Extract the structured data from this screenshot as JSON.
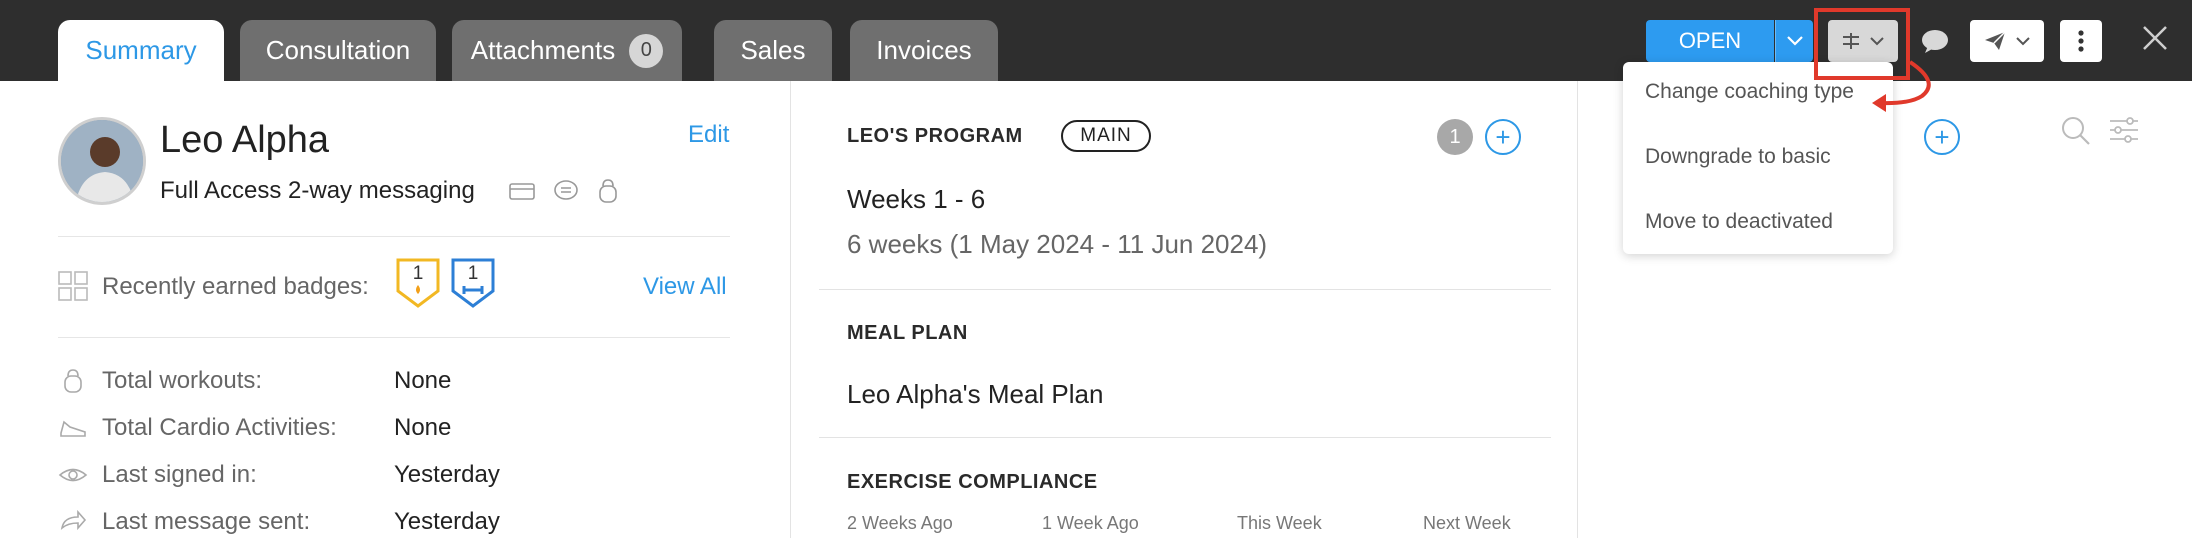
{
  "tabs": [
    {
      "label": "Summary",
      "active": true
    },
    {
      "label": "Consultation"
    },
    {
      "label": "Attachments",
      "count": "0"
    },
    {
      "label": "Sales"
    },
    {
      "label": "Invoices"
    }
  ],
  "toolbar": {
    "status_label": "OPEN",
    "accent_color": "#2d9bf0",
    "highlight_color": "#e0392b"
  },
  "dropdown": {
    "items": [
      "Change coaching type",
      "Downgrade to basic",
      "Move to deactivated"
    ]
  },
  "profile": {
    "name": "Leo Alpha",
    "plan": "Full Access 2-way messaging",
    "edit_label": "Edit"
  },
  "badges": {
    "label": "Recently earned badges:",
    "items": [
      {
        "count": "1",
        "color": "#f2b823",
        "icon": "flame-icon"
      },
      {
        "count": "1",
        "color": "#2d7fd6",
        "icon": "dumbbell-icon"
      }
    ],
    "view_all_label": "View All"
  },
  "stats": [
    {
      "label": "Total workouts:",
      "value": "None",
      "icon": "kettlebell-icon"
    },
    {
      "label": "Total Cardio Activities:",
      "value": "None",
      "icon": "shoe-icon"
    },
    {
      "label": "Last signed in:",
      "value": "Yesterday",
      "icon": "eye-icon"
    },
    {
      "label": "Last message sent:",
      "value": "Yesterday",
      "icon": "reply-icon"
    }
  ],
  "program": {
    "title": "LEO'S PROGRAM",
    "tag": "MAIN",
    "count": "1",
    "weeks": "Weeks 1 - 6",
    "duration": "6 weeks (1 May 2024 - 11 Jun 2024)"
  },
  "meal_plan": {
    "title": "MEAL PLAN",
    "name": "Leo Alpha's Meal Plan"
  },
  "exercise_compliance": {
    "title": "EXERCISE COMPLIANCE",
    "columns": [
      "2 Weeks Ago",
      "1 Week Ago",
      "This Week",
      "Next Week"
    ]
  }
}
